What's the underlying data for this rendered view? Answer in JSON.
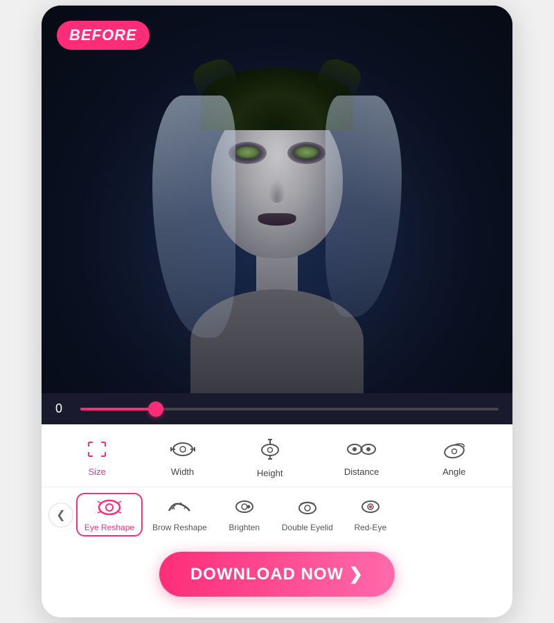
{
  "card": {
    "before_label": "BEFORE",
    "slider": {
      "value": "0",
      "fill_percent": 18
    },
    "tools_row1": [
      {
        "id": "size",
        "label": "Size",
        "active": false,
        "icon": "resize"
      },
      {
        "id": "width",
        "label": "Width",
        "active": false,
        "icon": "eye-width"
      },
      {
        "id": "height",
        "label": "Height",
        "active": false,
        "icon": "eye-height"
      },
      {
        "id": "distance",
        "label": "Distance",
        "active": false,
        "icon": "eye-distance"
      },
      {
        "id": "angle",
        "label": "Angle",
        "active": false,
        "icon": "eye-angle"
      }
    ],
    "tools_row2": [
      {
        "id": "eye-reshape",
        "label": "Eye Reshape",
        "active": true
      },
      {
        "id": "brow-reshape",
        "label": "Brow Reshape",
        "active": false
      },
      {
        "id": "brighten",
        "label": "Brighten",
        "active": false
      },
      {
        "id": "double-eyelid",
        "label": "Double Eyelid",
        "active": false
      },
      {
        "id": "red-eye",
        "label": "Red-Eye",
        "active": false
      }
    ],
    "download_button": "DOWNLOAD NOW ❯",
    "nav_back_label": "❮"
  }
}
